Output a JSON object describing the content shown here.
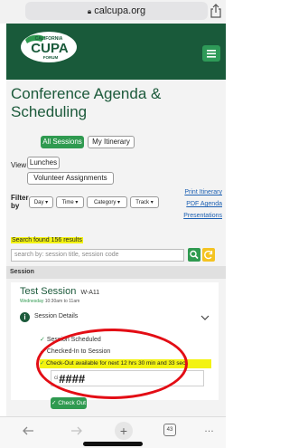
{
  "browser": {
    "url": "calcupa.org",
    "tab_count": "43"
  },
  "header": {
    "logo_line1": "CALIFORNIA",
    "logo_main": "CUPA",
    "logo_line2": "FORUM"
  },
  "page_title_line1": "Conference Agenda &",
  "page_title_line2": "Scheduling",
  "view": {
    "label": "View",
    "buttons": [
      "All Sessions",
      "My Itinerary",
      "Lunches",
      "Volunteer Assignments"
    ]
  },
  "filter": {
    "label_line1": "Filter",
    "label_line2": "by",
    "dropdowns": [
      "Day",
      "Time",
      "Category",
      "Track"
    ],
    "links": [
      "Print Itinerary",
      "PDF Agenda",
      "Presentations"
    ]
  },
  "search": {
    "results_text": "Search found 156 results",
    "placeholder": "search by: session title, session code"
  },
  "session_column": "Session",
  "session": {
    "title": "Test Session",
    "code": "W-A11",
    "day": "Wednesday",
    "time": "10:30am to 11am",
    "details_label": "Session Details",
    "scheduled": "Session Scheduled",
    "checked_in": "Checked-In to Session",
    "checkout_note": "Check-Out available for next 12 hrs 30 min and 33 sec",
    "code_value": "####",
    "checkout_button": "Check Out"
  },
  "colors": {
    "brand_green": "#195a3a",
    "accent_green": "#2f9a50",
    "highlight": "#f3f312",
    "annotation_red": "#e30d15"
  }
}
